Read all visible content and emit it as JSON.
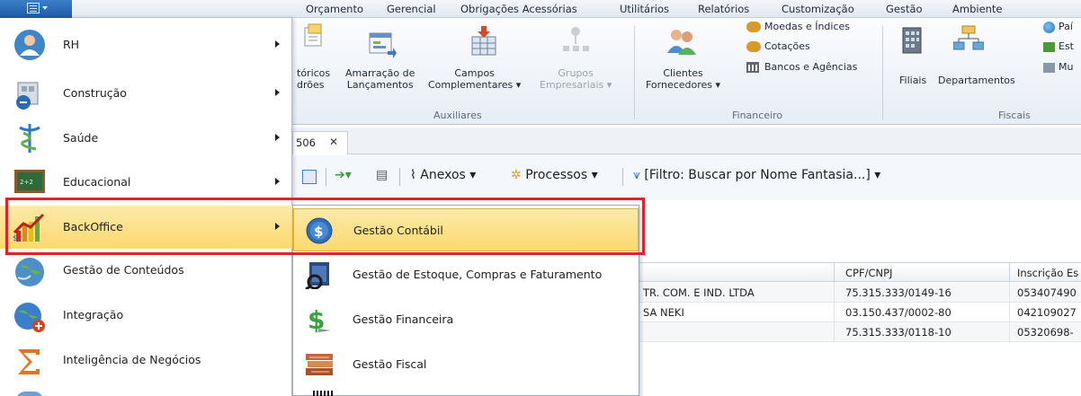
{
  "menubar": {
    "tabs": [
      "Orçamento",
      "Gerencial",
      "Obrigações Acessórias",
      "Utilitários",
      "Relatórios",
      "Customização",
      "Gestão",
      "Ambiente"
    ]
  },
  "ribbon": {
    "buttons": {
      "relatorios_padroes": [
        "tóricos",
        "drões"
      ],
      "amarracao": [
        "Amarração de",
        "Lançamentos"
      ],
      "campos": [
        "Campos",
        "Complementares ▾"
      ],
      "grupos": [
        "Grupos",
        "Empresariais ▾"
      ],
      "clientes": [
        "Clientes",
        "Fornecedores ▾"
      ],
      "moedas": "Moedas e Índices",
      "cotacoes": "Cotações",
      "bancos": "Bancos e Agências",
      "filiais": "Filiais",
      "departamentos": "Departamentos",
      "paises": "Paí",
      "estados": "Est",
      "municipios": "Mu"
    },
    "groups": {
      "auxiliares": "Auxiliares",
      "financeiro": "Financeiro",
      "fiscais": "Fiscais"
    }
  },
  "document_tab": {
    "label": "506",
    "close": "✕"
  },
  "toolbar": {
    "anexos": "Anexos",
    "processos": "Processos",
    "filtro": "[Filtro: Buscar por Nome Fantasia...]"
  },
  "grid": {
    "columns": [
      "CPF/CNPJ",
      "Inscrição Es"
    ],
    "rows": [
      {
        "name": "TR. COM. E IND. LTDA",
        "cnpj": "75.315.333/0149-16",
        "ie": "053407490"
      },
      {
        "name": "SA NEKI",
        "cnpj": "03.150.437/0002-80",
        "ie": "042109027"
      },
      {
        "name": "",
        "cnpj": "75.315.333/0118-10",
        "ie": "05320698-"
      }
    ]
  },
  "app_menu": {
    "items": [
      {
        "label": "RH",
        "icon": "rh-user-icon",
        "has_submenu": true
      },
      {
        "label": "Construção",
        "icon": "construction-icon",
        "has_submenu": true
      },
      {
        "label": "Saúde",
        "icon": "health-caduceus-icon",
        "has_submenu": true
      },
      {
        "label": "Educacional",
        "icon": "chalkboard-icon",
        "has_submenu": true
      },
      {
        "label": "BackOffice",
        "icon": "backoffice-chart-icon",
        "has_submenu": true,
        "active": true
      },
      {
        "label": "Gestão de Conteúdos",
        "icon": "content-globe-icon",
        "has_submenu": false
      },
      {
        "label": "Integração",
        "icon": "integration-globe-icon",
        "has_submenu": false
      },
      {
        "label": "Inteligência de Negócios",
        "icon": "sigma-icon",
        "has_submenu": false
      }
    ]
  },
  "submenu": {
    "items": [
      {
        "label": "Gestão Contábil",
        "icon": "dollar-coin-icon",
        "active": true
      },
      {
        "label": "Gestão de Estoque, Compras e Faturamento",
        "icon": "stock-icon"
      },
      {
        "label": "Gestão Financeira",
        "icon": "finance-dollar-icon"
      },
      {
        "label": "Gestão Fiscal",
        "icon": "fiscal-books-icon"
      }
    ]
  },
  "colors": {
    "highlight": "#e3212b",
    "active_item": "#fbd96f",
    "ribbon_blue": "#1d5aa5"
  }
}
